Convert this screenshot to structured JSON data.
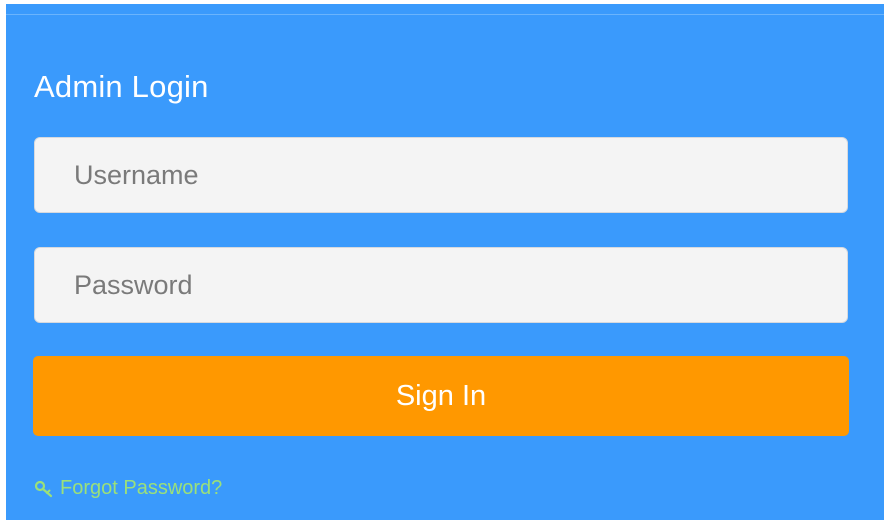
{
  "login": {
    "title": "Admin Login",
    "username_placeholder": "Username",
    "username_value": "",
    "password_placeholder": "Password",
    "password_value": "",
    "signin_label": "Sign In",
    "forgot_label": "Forgot Password?",
    "forgot_icon": "key-icon"
  },
  "colors": {
    "panel": "#3a9afc",
    "button": "#ff9800",
    "link": "#9be07a"
  }
}
